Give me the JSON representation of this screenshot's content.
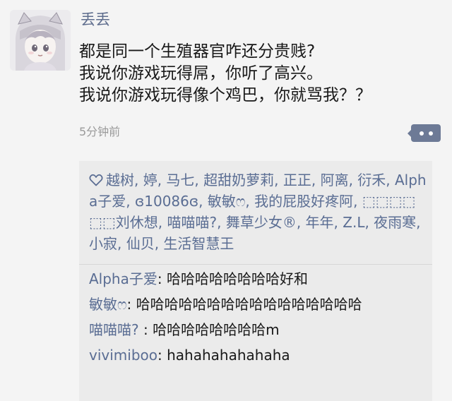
{
  "post": {
    "username": "丢丢",
    "lines": [
      "都是同一个生殖器官咋还分贵贱?",
      "我说你游戏玩得屌，你听了高兴。",
      "我说你游戏玩得像个鸡巴，你就骂我？？"
    ],
    "time": "5分钟前"
  },
  "likes": {
    "text": "越树, 婷, 马七, 超甜奶萝莉, 正正, 阿离, 衍禾, Alpha子爱, ɞ10086ɞ, 敏敏ෆ, 我的屁股好疼阿, ⬚⬚⬚⬚⬚⬚刘休想, 喵喵喵?, 舞草少女®, 年年, Z.L, 夜雨寒, 小寂, 仙贝, 生活智慧王"
  },
  "comments": [
    {
      "author": "Alpha子爱",
      "sep": ": ",
      "text": "哈哈哈哈哈哈哈哈好和"
    },
    {
      "author": "敏敏ෆ",
      "sep": ": ",
      "text": "哈哈哈哈哈哈哈哈哈哈哈哈哈哈哈哈"
    },
    {
      "author": "喵喵喵?",
      "sep": " : ",
      "text": "哈哈哈哈哈哈哈哈m"
    },
    {
      "author": "vivimiboo",
      "sep": ": ",
      "text": "hahahahahahaha"
    }
  ],
  "icons": {
    "avatar": "anime-girl-avatar",
    "like": "heart-outline-icon",
    "more": "more-dots-icon"
  },
  "colors": {
    "name": "#5e6d8d",
    "link": "#5a6d93",
    "timestamp": "#9a9a9a",
    "box": "#ebebeb",
    "background": "#f4f4f4"
  }
}
